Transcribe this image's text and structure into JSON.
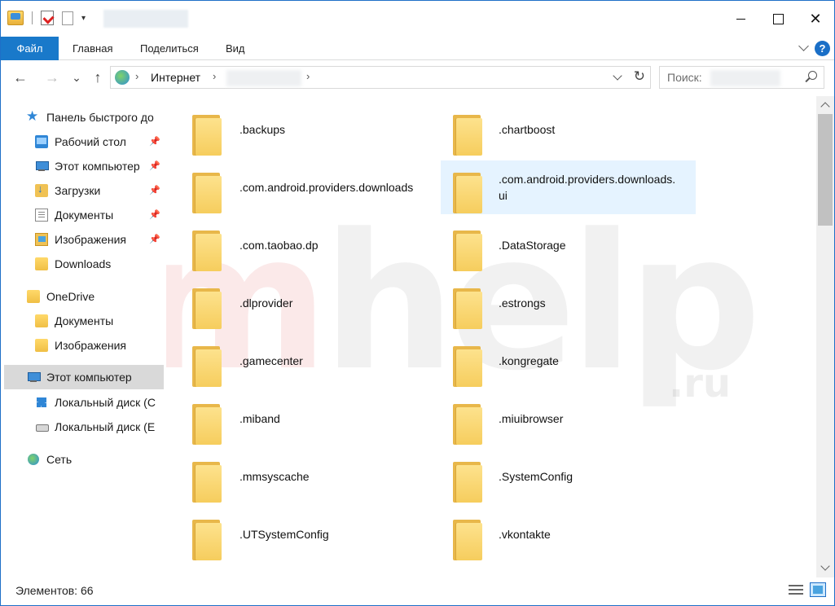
{
  "titlebar": {
    "minimize_label": "",
    "maximize_label": "",
    "close_label": "✕",
    "qat_dropdown": "▾"
  },
  "ribbon": {
    "tabs": [
      {
        "label": "Файл"
      },
      {
        "label": "Главная"
      },
      {
        "label": "Поделиться"
      },
      {
        "label": "Вид"
      }
    ],
    "help": "?"
  },
  "nav": {
    "back": "←",
    "forward": "→",
    "recent": "⌄",
    "up": "↑",
    "address_segment": "Интернет",
    "sep": "›",
    "refresh": "↻",
    "search_placeholder": "Поиск:"
  },
  "sidebar": {
    "items": [
      {
        "label": "Панель быстрого до",
        "icon": "quick-access-star-icon"
      },
      {
        "label": "Рабочий стол",
        "icon": "desktop-icon",
        "pinned": true
      },
      {
        "label": "Этот компьютер",
        "icon": "computer-icon",
        "pinned": true
      },
      {
        "label": "Загрузки",
        "icon": "downloads-icon",
        "pinned": true
      },
      {
        "label": "Документы",
        "icon": "documents-icon",
        "pinned": true
      },
      {
        "label": "Изображения",
        "icon": "pictures-icon",
        "pinned": true
      },
      {
        "label": "Downloads",
        "icon": "folder-icon"
      },
      {
        "label": "OneDrive",
        "icon": "onedrive-icon"
      },
      {
        "label": "Документы",
        "icon": "folder-icon"
      },
      {
        "label": "Изображения",
        "icon": "folder-icon"
      },
      {
        "label": "Этот компьютер",
        "icon": "computer-icon",
        "selected": true
      },
      {
        "label": "Локальный диск (C",
        "icon": "windows-drive-icon"
      },
      {
        "label": "Локальный диск (E",
        "icon": "drive-icon"
      },
      {
        "label": "Сеть",
        "icon": "network-icon"
      }
    ],
    "pin_glyph": "📌"
  },
  "content": {
    "items": [
      {
        "name": ".backups"
      },
      {
        "name": ".chartboost"
      },
      {
        "name": ".com.android.providers.downloads"
      },
      {
        "name": ".com.android.providers.downloads.\nui",
        "selected": true
      },
      {
        "name": ".com.taobao.dp"
      },
      {
        "name": ".DataStorage"
      },
      {
        "name": ".dlprovider"
      },
      {
        "name": ".estrongs"
      },
      {
        "name": ".gamecenter"
      },
      {
        "name": ".kongregate"
      },
      {
        "name": ".miband"
      },
      {
        "name": ".miuibrowser"
      },
      {
        "name": ".mmsyscache"
      },
      {
        "name": ".SystemConfig"
      },
      {
        "name": ".UTSystemConfig"
      },
      {
        "name": ".vkontakte"
      }
    ]
  },
  "status": {
    "item_count": "Элементов: 66"
  },
  "watermark": {
    "main": "help",
    "prefix": "m",
    "suffix": ".ru"
  },
  "colors": {
    "accent": "#1979ca",
    "selection": "#e5f3ff",
    "folder": "#f6cd5d"
  }
}
